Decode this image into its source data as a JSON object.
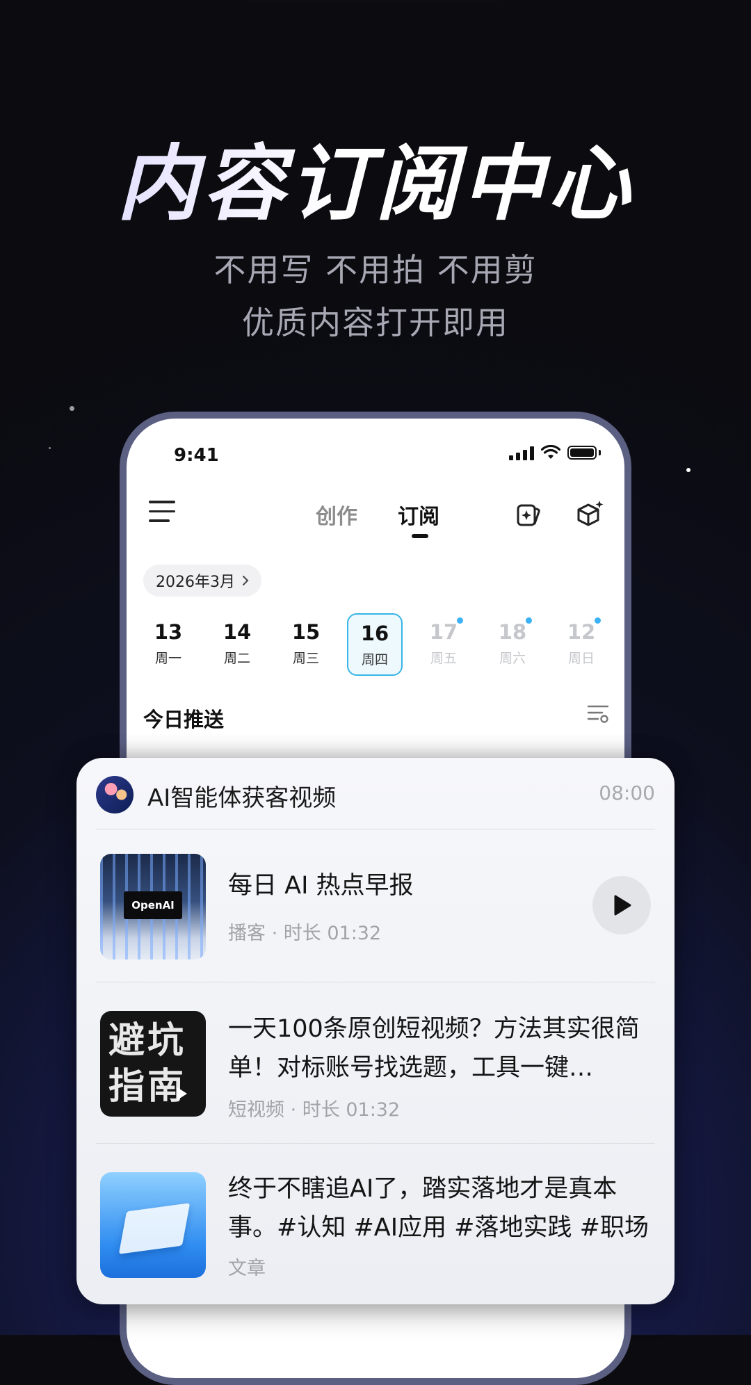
{
  "hero": {
    "title": "内容订阅中心",
    "subtitle_line1": "不用写 不用拍 不用剪",
    "subtitle_line2": "优质内容打开即用"
  },
  "status_bar": {
    "time": "9:41"
  },
  "top_nav": {
    "tabs": [
      {
        "label": "创作",
        "active": false
      },
      {
        "label": "订阅",
        "active": true
      }
    ]
  },
  "calendar": {
    "month_label": "2026年3月",
    "days": [
      {
        "num": "13",
        "weekday": "周一",
        "state": "past"
      },
      {
        "num": "14",
        "weekday": "周二",
        "state": "past"
      },
      {
        "num": "15",
        "weekday": "周三",
        "state": "past"
      },
      {
        "num": "16",
        "weekday": "周四",
        "state": "active"
      },
      {
        "num": "17",
        "weekday": "周五",
        "state": "future",
        "dot": true
      },
      {
        "num": "18",
        "weekday": "周六",
        "state": "future",
        "dot": true
      },
      {
        "num": "12",
        "weekday": "周日",
        "state": "future",
        "dot": true
      }
    ]
  },
  "today": {
    "title": "今日推送"
  },
  "feed_card": {
    "channel_name": "AI智能体获客视频",
    "time": "08:00",
    "items": [
      {
        "title": "每日 AI 热点早报",
        "meta_type": "播客",
        "meta_duration": "时长 01:32",
        "thumb_label": "OpenAI"
      },
      {
        "title": "一天100条原创短视频？方法其实很简单！对标账号找选题，工具一键…",
        "meta_type": "短视频",
        "meta_duration": "时长 01:32",
        "thumb_label": "避坑指南"
      },
      {
        "title": "终于不瞎追AI了，踏实落地才是真本事。#认知 #AI应用 #落地实践 #职场",
        "meta_type": "文章"
      }
    ]
  },
  "colors": {
    "accent": "#37b5e8",
    "dot": "#3bb2f5",
    "background": "#0b0b10"
  }
}
